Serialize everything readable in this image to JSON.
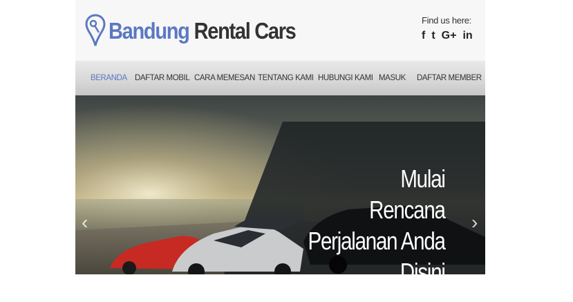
{
  "header": {
    "logo_word1": "Bandung",
    "logo_word2": "Rental Cars",
    "social_label": "Find us here:",
    "social_icons": [
      "f",
      "t",
      "G+",
      "in"
    ]
  },
  "nav": {
    "items": [
      "BERANDA",
      "DAFTAR MOBIL",
      "CARA MEMESAN",
      "TENTANG KAMI",
      "HUBUNGI KAMI",
      "MASUK",
      "DAFTAR MEMBER"
    ],
    "active_index": 0
  },
  "hero": {
    "lines": [
      "Mulai",
      "Rencana",
      "Perjalanan Anda",
      "Disini"
    ],
    "prev_arrow": "‹",
    "next_arrow": "›"
  },
  "colors": {
    "accent": "#5c78c2",
    "nav_text": "#333333"
  }
}
